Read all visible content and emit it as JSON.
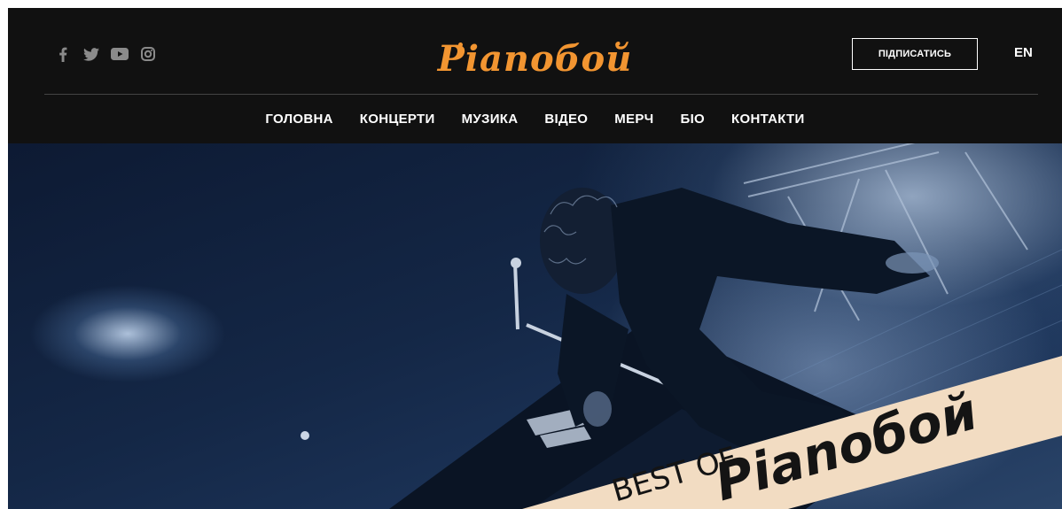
{
  "header": {
    "logo": "Pianoбой",
    "subscribe_label": "ПІДПИСАТИСЬ",
    "lang_label": "EN",
    "social": [
      {
        "icon": "facebook-icon",
        "label": "f"
      },
      {
        "icon": "twitter-icon"
      },
      {
        "icon": "youtube-icon"
      },
      {
        "icon": "instagram-icon"
      }
    ]
  },
  "nav": {
    "items": [
      "ГОЛОВНА",
      "КОНЦЕРТИ",
      "МУЗИКА",
      "ВІДЕО",
      "МЕРЧ",
      "БІО",
      "КОНТАКТИ"
    ]
  },
  "hero": {
    "banner_line1": "BEST OF",
    "banner_logo": "Pianoбой"
  },
  "colors": {
    "accent": "#f29531",
    "header_bg": "#111111",
    "banner": "#f2dcc2"
  }
}
